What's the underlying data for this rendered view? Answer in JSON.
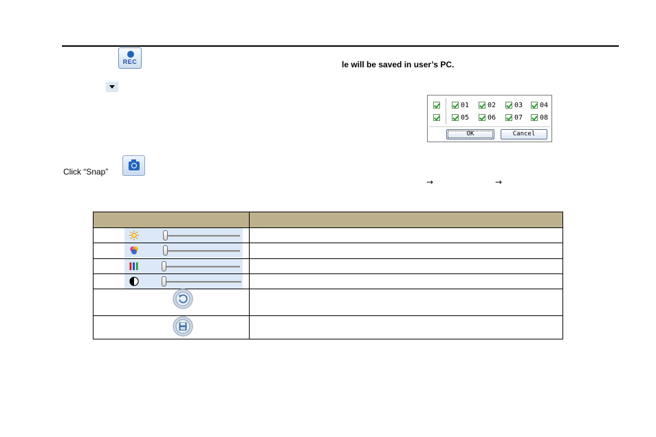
{
  "top": {
    "rec_button_label": "REC",
    "saved_note": "le will be saved in user’s PC."
  },
  "channel_dialog": {
    "row1_channels": [
      "01",
      "02",
      "03",
      "04"
    ],
    "row2_channels": [
      "05",
      "06",
      "07",
      "08"
    ],
    "ok_label": "OK",
    "cancel_label": "Cancel"
  },
  "snap": {
    "label": "Click “Snap”",
    "arrow": "→"
  },
  "table": {
    "header_col1": "",
    "header_col2": "",
    "rows": [
      {
        "icon": "brightness-icon",
        "level": 0.02
      },
      {
        "icon": "hue-icon",
        "level": 0.02
      },
      {
        "icon": "saturation-icon",
        "level": 0.0
      },
      {
        "icon": "contrast-icon",
        "level": 0.0
      },
      {
        "icon": "reset-icon"
      },
      {
        "icon": "save-icon"
      }
    ]
  },
  "colors": {
    "header_bg": "#bdb08d",
    "accent_blue": "#1f64b8",
    "slider_bg": "#dce8f7"
  }
}
